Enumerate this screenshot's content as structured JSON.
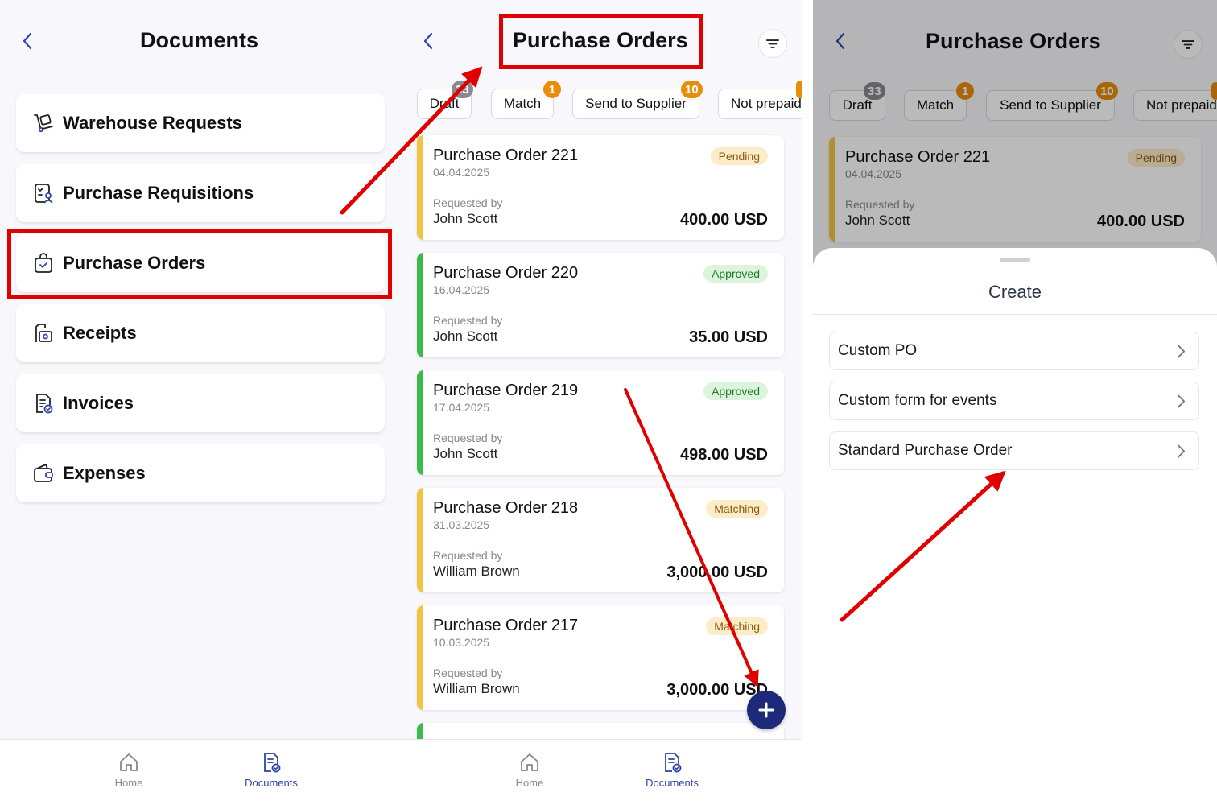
{
  "docs": {
    "title": "Documents",
    "items": [
      {
        "label": "Warehouse Requests",
        "icon": "dolly-icon"
      },
      {
        "label": "Purchase Requisitions",
        "icon": "requisition-icon"
      },
      {
        "label": "Purchase Orders",
        "icon": "shopping-bag-check-icon"
      },
      {
        "label": "Receipts",
        "icon": "receipt-icon"
      },
      {
        "label": "Invoices",
        "icon": "invoice-icon"
      },
      {
        "label": "Expenses",
        "icon": "wallet-icon"
      }
    ]
  },
  "po": {
    "title": "Purchase Orders",
    "tabs": [
      {
        "label": "Draft",
        "badge": "33"
      },
      {
        "label": "Match",
        "badge": "1"
      },
      {
        "label": "Send to Supplier",
        "badge": "10"
      },
      {
        "label": "Not prepaid",
        "badge": ""
      }
    ],
    "requested_by_label": "Requested by",
    "orders": [
      {
        "title": "Purchase Order 221",
        "date": "04.04.2025",
        "requester": "John Scott",
        "amount": "400.00 USD",
        "status": "Pending"
      },
      {
        "title": "Purchase Order 220",
        "date": "16.04.2025",
        "requester": "John Scott",
        "amount": "35.00 USD",
        "status": "Approved"
      },
      {
        "title": "Purchase Order 219",
        "date": "17.04.2025",
        "requester": "John Scott",
        "amount": "498.00 USD",
        "status": "Approved"
      },
      {
        "title": "Purchase Order 218",
        "date": "31.03.2025",
        "requester": "William Brown",
        "amount": "3,000.00 USD",
        "status": "Matching"
      },
      {
        "title": "Purchase Order 217",
        "date": "10.03.2025",
        "requester": "William Brown",
        "amount": "3,000.00 USD",
        "status": "Matching"
      }
    ]
  },
  "nav": {
    "home": "Home",
    "documents": "Documents"
  },
  "create": {
    "title": "Create",
    "options": [
      "Custom PO",
      "Custom form for events",
      "Standard Purchase Order"
    ]
  },
  "colors": {
    "accent": "#2f44a8",
    "fab": "#1d2a7a",
    "pending_bar": "#f2c443",
    "approved_bar": "#3dba4e",
    "pending_badge_bg": "#fdecc8",
    "pending_badge_text": "#8a5a10",
    "approved_badge_bg": "#dcf3dc",
    "approved_badge_text": "#1c7a2c",
    "tab_badge_grey": "#8a8a8e",
    "tab_badge_orange": "#e88c0a",
    "annotation": "#e00000"
  }
}
